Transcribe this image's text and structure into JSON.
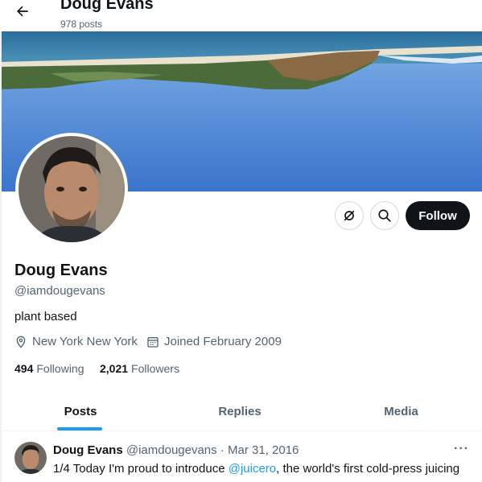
{
  "header": {
    "title": "Doug Evans",
    "post_count": "978 posts"
  },
  "profile": {
    "name": "Doug Evans",
    "handle": "@iamdougevans",
    "bio": "plant based",
    "location": "New York New York",
    "joined": "Joined February 2009",
    "following_count": "494",
    "following_label": "Following",
    "followers_count": "2,021",
    "followers_label": "Followers",
    "follow_button": "Follow"
  },
  "tabs": [
    {
      "label": "Posts",
      "active": true
    },
    {
      "label": "Replies",
      "active": false
    },
    {
      "label": "Media",
      "active": false
    }
  ],
  "tweet": {
    "name": "Doug Evans",
    "handle": "@iamdougevans",
    "separator": "·",
    "date": "Mar 31, 2016",
    "more": "···",
    "text_before": "1/4 Today I'm proud to introduce ",
    "mention": "@juicero",
    "text_after": ", the world's first cold-press juicing"
  },
  "colors": {
    "accent": "#1d9bf0",
    "text": "#0f1419",
    "muted": "#536471",
    "follow_bg": "#0f1419"
  },
  "icons": [
    "back-arrow-icon",
    "no-notifications-icon",
    "search-icon",
    "location-pin-icon",
    "calendar-icon"
  ]
}
